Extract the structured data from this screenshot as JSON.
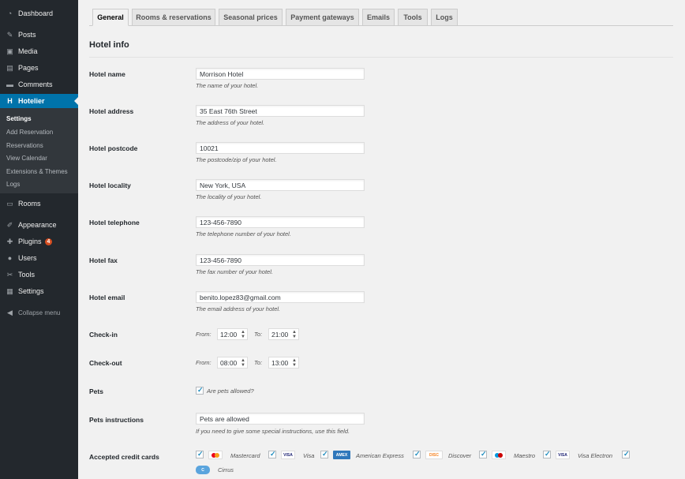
{
  "sidebar": {
    "items": [
      {
        "label": "Dashboard",
        "icon": "dashboard-icon",
        "glyph": "◔"
      },
      {
        "label": "Posts",
        "icon": "pin-icon",
        "glyph": "✎"
      },
      {
        "label": "Media",
        "icon": "media-icon",
        "glyph": "▣"
      },
      {
        "label": "Pages",
        "icon": "pages-icon",
        "glyph": "▤"
      },
      {
        "label": "Comments",
        "icon": "comment-icon",
        "glyph": "▬"
      },
      {
        "label": "Hotelier",
        "icon": "hotelier-icon",
        "glyph": "H"
      },
      {
        "label": "Rooms",
        "icon": "bed-icon",
        "glyph": "▭"
      },
      {
        "label": "Appearance",
        "icon": "brush-icon",
        "glyph": "✐"
      },
      {
        "label": "Plugins",
        "icon": "plugin-icon",
        "glyph": "✚",
        "badge": "4"
      },
      {
        "label": "Users",
        "icon": "user-icon",
        "glyph": "●"
      },
      {
        "label": "Tools",
        "icon": "wrench-icon",
        "glyph": "✂"
      },
      {
        "label": "Settings",
        "icon": "settings-icon",
        "glyph": "▦"
      }
    ],
    "submenu": [
      "Settings",
      "Add Reservation",
      "Reservations",
      "View Calendar",
      "Extensions & Themes",
      "Logs"
    ],
    "collapse": "Collapse menu"
  },
  "tabs": [
    "General",
    "Rooms & reservations",
    "Seasonal prices",
    "Payment gateways",
    "Emails",
    "Tools",
    "Logs"
  ],
  "section_title": "Hotel info",
  "fields": [
    {
      "label": "Hotel name",
      "value": "Morrison Hotel",
      "desc": "The name of your hotel."
    },
    {
      "label": "Hotel address",
      "value": "35 East 76th Street",
      "desc": "The address of your hotel."
    },
    {
      "label": "Hotel postcode",
      "value": "10021",
      "desc": "The postcode/zip of your hotel."
    },
    {
      "label": "Hotel locality",
      "value": "New York, USA",
      "desc": "The locality of your hotel."
    },
    {
      "label": "Hotel telephone",
      "value": "123-456-7890",
      "desc": "The telephone number of your hotel."
    },
    {
      "label": "Hotel fax",
      "value": "123-456-7890",
      "desc": "The fax number of your hotel."
    },
    {
      "label": "Hotel email",
      "value": "benito.lopez83@gmail.com",
      "desc": "The email address of your hotel."
    }
  ],
  "checkin": {
    "label": "Check-in",
    "from_label": "From:",
    "from": "12:00",
    "to_label": "To:",
    "to": "21:00"
  },
  "checkout": {
    "label": "Check-out",
    "from_label": "From:",
    "from": "08:00",
    "to_label": "To:",
    "to": "13:00"
  },
  "pets": {
    "label": "Pets",
    "checkbox_label": "Are pets allowed?",
    "checked": true
  },
  "pets_instructions": {
    "label": "Pets instructions",
    "value": "Pets are allowed",
    "desc": "If you need to give some special instructions, use this field."
  },
  "credit_cards": {
    "label": "Accepted credit cards",
    "cards": [
      {
        "name": "Mastercard",
        "logo_text": "MC",
        "color": "#f79e1b"
      },
      {
        "name": "Visa",
        "logo_text": "VISA",
        "color": "#1a1f71"
      },
      {
        "name": "American Express",
        "logo_text": "AMEX",
        "color": "#2e77bb"
      },
      {
        "name": "Discover",
        "logo_text": "DISC",
        "color": "#f58220"
      },
      {
        "name": "Maestro",
        "logo_text": "M",
        "color": "#cc0000"
      },
      {
        "name": "Visa Electron",
        "logo_text": "VISA",
        "color": "#1a1f71"
      },
      {
        "name": "Cirrus",
        "logo_text": "C",
        "color": "#5aa4dd"
      }
    ]
  },
  "colors": {
    "sidebar_bg": "#23282d",
    "accent": "#0073aa",
    "badge": "#d54e21"
  }
}
